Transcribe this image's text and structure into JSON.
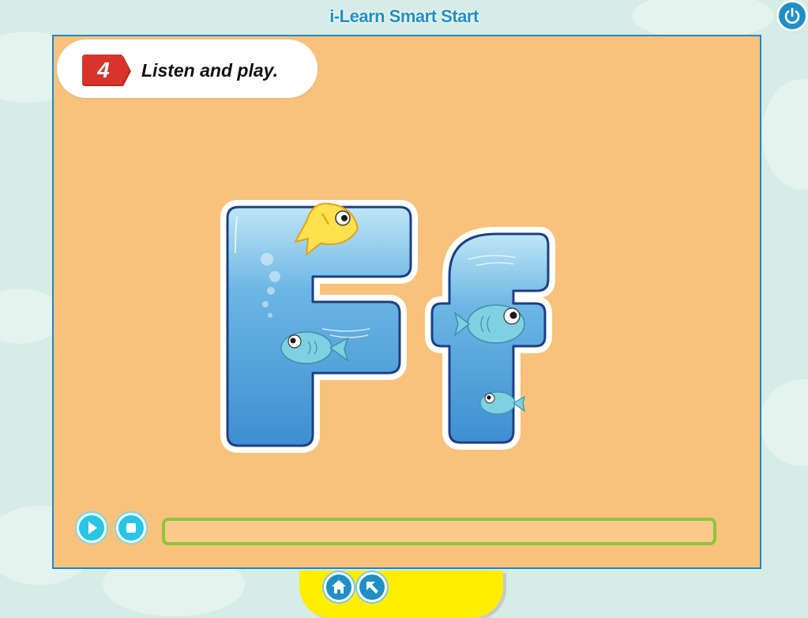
{
  "app": {
    "title": "i-Learn Smart Start"
  },
  "instruction": {
    "number": "4",
    "text": "Listen and play."
  },
  "letters": {
    "uppercase": "F",
    "lowercase": "f"
  },
  "audio_controls": {
    "play_icon": "play-icon",
    "stop_icon": "stop-icon",
    "progress": 0
  },
  "navigation": {
    "home_icon": "home-icon",
    "back_icon": "back-arrow-icon",
    "power_icon": "power-icon"
  },
  "colors": {
    "stage_background": "#f8c27c",
    "title_blue": "#1f8fc6",
    "badge_red": "#d8342c",
    "progress_green": "#8cc63f",
    "control_cyan": "#27c5e6",
    "nav_yellow": "#ffee00"
  }
}
